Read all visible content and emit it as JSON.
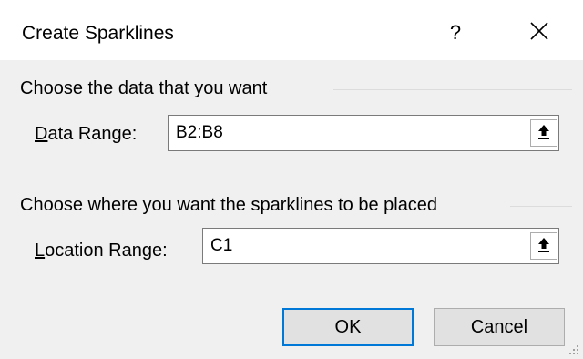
{
  "dialog": {
    "title": "Create Sparklines",
    "help_label": "?",
    "close_icon": "close-icon"
  },
  "data_group": {
    "heading": "Choose the data that you want",
    "label_accel": "D",
    "label_rest": "ata Range:",
    "value": "B2:B8",
    "collapse_icon": "collapse-dialog-icon"
  },
  "location_group": {
    "heading": "Choose where you want the sparklines to be placed",
    "label_accel": "L",
    "label_rest": "ocation Range:",
    "value": "C1",
    "collapse_icon": "collapse-dialog-icon"
  },
  "buttons": {
    "ok_label": "OK",
    "cancel_label": "Cancel"
  },
  "colors": {
    "accent": "#0078d7",
    "background": "#f0f0f0",
    "title_bar": "#ffffff"
  }
}
